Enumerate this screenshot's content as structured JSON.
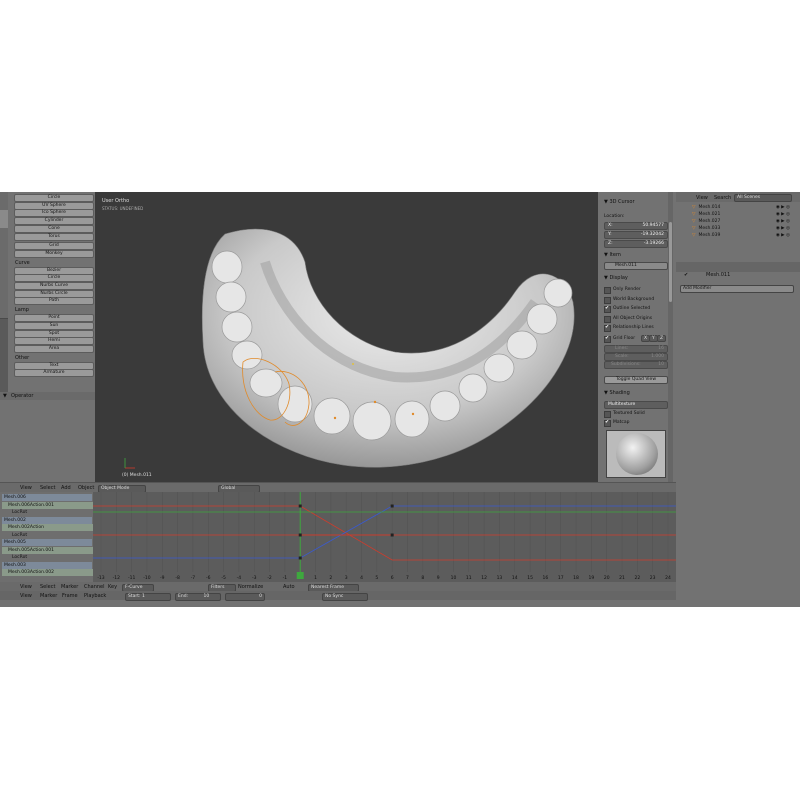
{
  "left_panel": {
    "add_buttons": [
      "Circle",
      "UV Sphere",
      "Ico Sphere",
      "Cylinder",
      "Cone",
      "Torus",
      "Grid",
      "Monkey"
    ],
    "curve_heading": "Curve",
    "curve_buttons": [
      "Bezier",
      "Circle",
      "Nurbs Curve",
      "Nurbs Circle",
      "Path"
    ],
    "lamp_heading": "Lamp",
    "lamp_buttons": [
      "Point",
      "Sun",
      "Spot",
      "Hemi",
      "Area"
    ],
    "other_heading": "Other",
    "other_buttons": [
      "Text",
      "Armature"
    ],
    "operator_label": "Operator"
  },
  "viewport": {
    "view_name": "User Ortho",
    "status": "STATUS: UNDEFINED",
    "object_label": "(0) Mesh.011"
  },
  "viewport_header": {
    "menus": [
      "View",
      "Select",
      "Add",
      "Object"
    ],
    "mode": "Object Mode",
    "orientation": "Global"
  },
  "properties": {
    "cursor_title": "3D Cursor",
    "location_label": "Location:",
    "x": "X:",
    "x_val": "50.94577",
    "y": "Y:",
    "y_val": "-19.32042",
    "z": "Z:",
    "z_val": "-3.19266",
    "item_title": "Item",
    "item_name": "Mesh.011",
    "display_title": "Display",
    "display_opts": [
      {
        "label": "Only Render",
        "checked": false
      },
      {
        "label": "World Background",
        "checked": false
      },
      {
        "label": "Outline Selected",
        "checked": true
      },
      {
        "label": "All Object Origins",
        "checked": false
      },
      {
        "label": "Relationship Lines",
        "checked": true
      }
    ],
    "grid_floor": "Grid Floor",
    "axes": [
      "X",
      "Y",
      "Z"
    ],
    "lines_label": "Lines:",
    "lines_val": "16",
    "scale_label": "Scale:",
    "scale_val": "1.000",
    "subdiv_label": "Subdivisions:",
    "subdiv_val": "10",
    "quad_button": "Toggle Quad View",
    "shading_title": "Shading",
    "shading_mode": "Multitexture",
    "textured_solid": "Textured Solid",
    "matcap": "Matcap"
  },
  "outliner": {
    "menus": [
      "View",
      "Search"
    ],
    "scene_select": "All Scenes",
    "items": [
      "Mesh.014",
      "Mesh.021",
      "Mesh.027",
      "Mesh.033",
      "Mesh.039"
    ],
    "selected_item": "Mesh.011",
    "add_modifier": "Add Modifier"
  },
  "dopesheet": {
    "channels": [
      {
        "label": "Mesh.006",
        "type": "object"
      },
      {
        "label": "Mesh.006Action.001",
        "type": "action"
      },
      {
        "label": "LocRot",
        "type": "group"
      },
      {
        "label": "Mesh.002",
        "type": "object"
      },
      {
        "label": "Mesh.002Action",
        "type": "action"
      },
      {
        "label": "LocRot",
        "type": "group"
      },
      {
        "label": "Mesh.005",
        "type": "object"
      },
      {
        "label": "Mesh.005Action.001",
        "type": "action"
      },
      {
        "label": "LocRot",
        "type": "group"
      },
      {
        "label": "Mesh.003",
        "type": "object"
      },
      {
        "label": "Mesh.003Action.002",
        "type": "action"
      }
    ],
    "frame_ticks": [
      "-13",
      "-12",
      "-11",
      "-10",
      "-9",
      "-8",
      "-7",
      "-6",
      "-5",
      "-4",
      "-3",
      "-2",
      "-1",
      "0",
      "1",
      "2",
      "3",
      "4",
      "5",
      "6",
      "7",
      "8",
      "9",
      "10",
      "11",
      "12",
      "13",
      "14",
      "15",
      "16",
      "17",
      "18",
      "19",
      "20",
      "21",
      "22",
      "23",
      "24"
    ],
    "current_frame": "0"
  },
  "graph_header": {
    "menus": [
      "View",
      "Select",
      "Marker",
      "Channel",
      "Key"
    ],
    "editor": "F-Curve",
    "filters": "Filters",
    "normalize": "Normalize",
    "auto": "Auto",
    "snap": "Nearest Frame"
  },
  "timeline_header": {
    "menus": [
      "View",
      "Marker",
      "Frame",
      "Playback"
    ],
    "start_label": "Start:",
    "start_val": "1",
    "end_label": "End:",
    "end_val": "10",
    "frame_val": "0",
    "sync": "No Sync"
  },
  "colors": {
    "red_curve": "#d23b2b",
    "green_curve": "#3ea83e",
    "blue_curve": "#3a5ad0",
    "selection": "#e08a2a"
  }
}
